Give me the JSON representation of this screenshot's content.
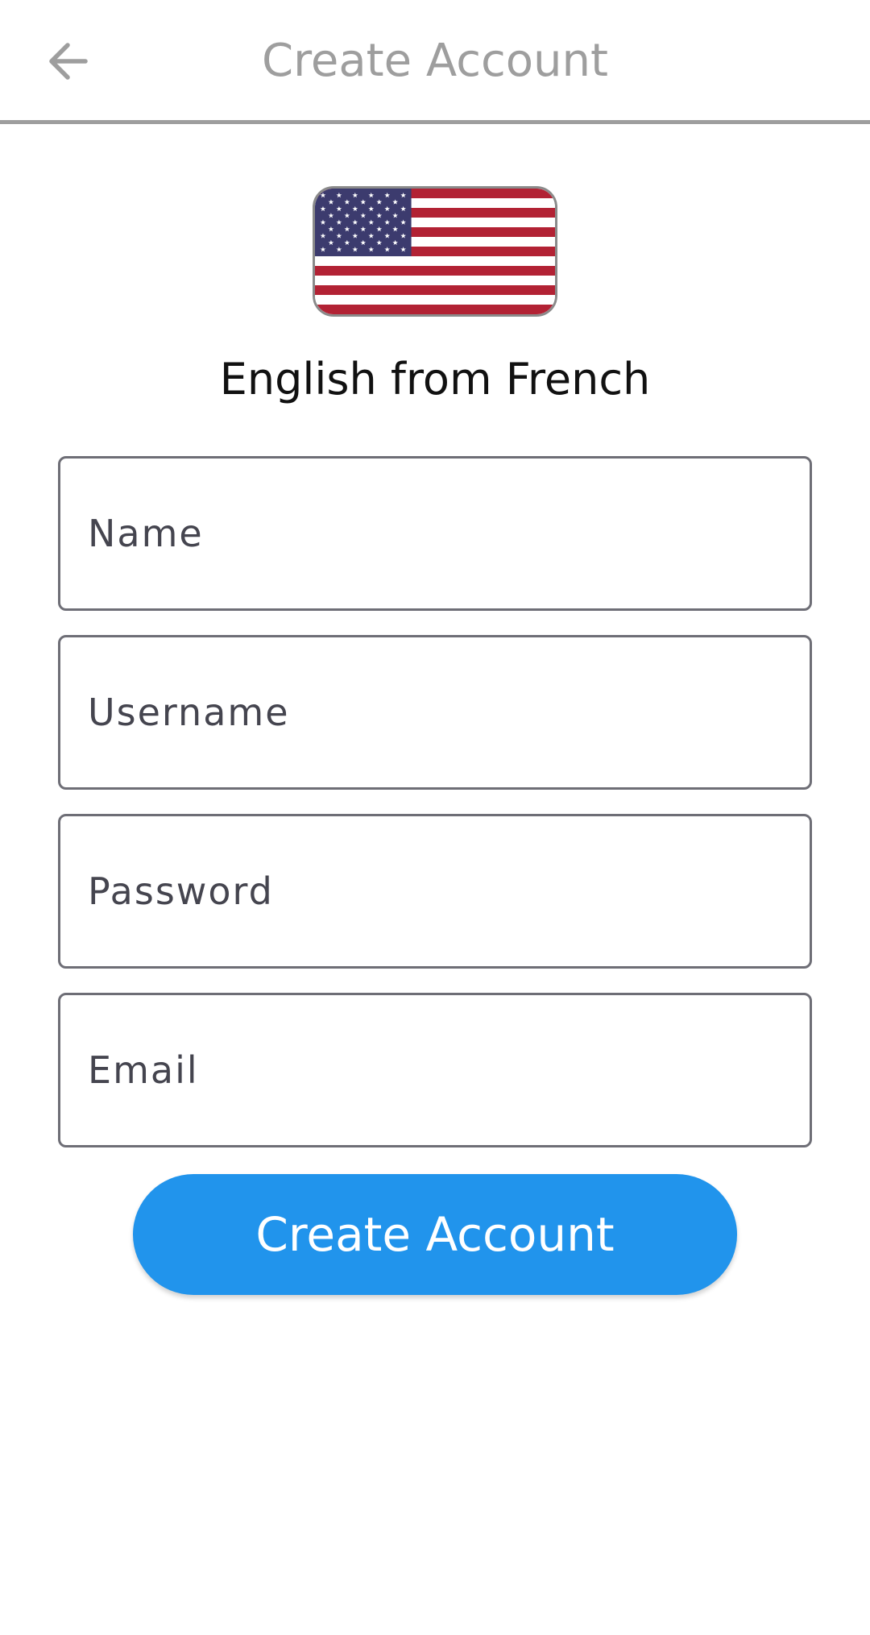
{
  "header": {
    "title": "Create Account",
    "back_icon": "arrow-left-icon"
  },
  "course": {
    "flag_icon": "us-flag-icon",
    "label": "English from French"
  },
  "form": {
    "name_placeholder": "Name",
    "username_placeholder": "Username",
    "password_placeholder": "Password",
    "email_placeholder": "Email",
    "submit_label": "Create Account"
  },
  "colors": {
    "accent": "#2194ec",
    "header_text": "#9e9e9e",
    "field_border": "#6e6e76"
  }
}
